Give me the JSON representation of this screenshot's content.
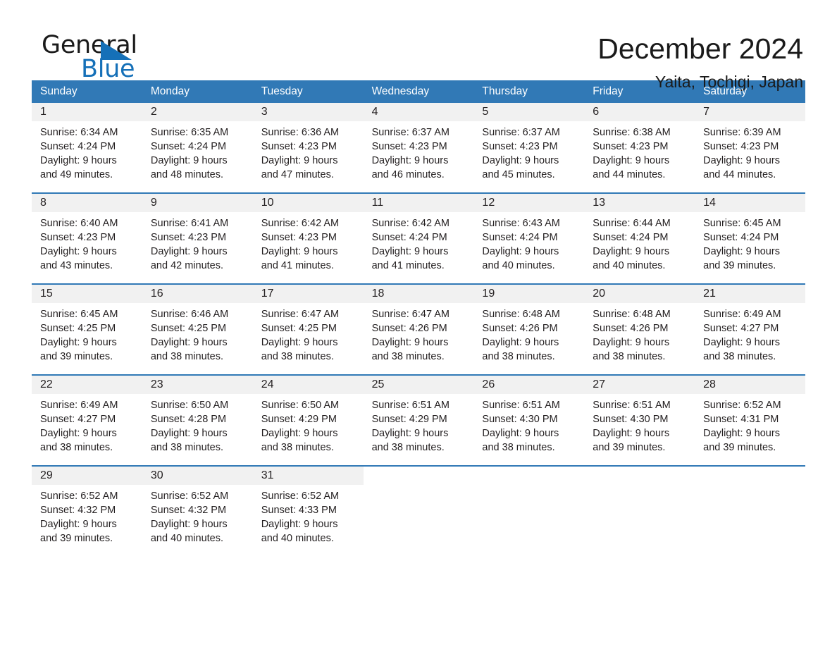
{
  "brand": {
    "name_part1": "General",
    "name_part2": "Blue",
    "accent_color": "#1570b8"
  },
  "header": {
    "title": "December 2024",
    "subtitle": "Yaita, Tochigi, Japan",
    "header_bg_color": "#3179b6",
    "row_divider_color": "#3179b6",
    "daynum_band_color": "#f1f1f1"
  },
  "weekdays": [
    "Sunday",
    "Monday",
    "Tuesday",
    "Wednesday",
    "Thursday",
    "Friday",
    "Saturday"
  ],
  "weeks": [
    [
      {
        "day": "1",
        "sunrise": "Sunrise: 6:34 AM",
        "sunset": "Sunset: 4:24 PM",
        "daylight1": "Daylight: 9 hours",
        "daylight2": "and 49 minutes."
      },
      {
        "day": "2",
        "sunrise": "Sunrise: 6:35 AM",
        "sunset": "Sunset: 4:24 PM",
        "daylight1": "Daylight: 9 hours",
        "daylight2": "and 48 minutes."
      },
      {
        "day": "3",
        "sunrise": "Sunrise: 6:36 AM",
        "sunset": "Sunset: 4:23 PM",
        "daylight1": "Daylight: 9 hours",
        "daylight2": "and 47 minutes."
      },
      {
        "day": "4",
        "sunrise": "Sunrise: 6:37 AM",
        "sunset": "Sunset: 4:23 PM",
        "daylight1": "Daylight: 9 hours",
        "daylight2": "and 46 minutes."
      },
      {
        "day": "5",
        "sunrise": "Sunrise: 6:37 AM",
        "sunset": "Sunset: 4:23 PM",
        "daylight1": "Daylight: 9 hours",
        "daylight2": "and 45 minutes."
      },
      {
        "day": "6",
        "sunrise": "Sunrise: 6:38 AM",
        "sunset": "Sunset: 4:23 PM",
        "daylight1": "Daylight: 9 hours",
        "daylight2": "and 44 minutes."
      },
      {
        "day": "7",
        "sunrise": "Sunrise: 6:39 AM",
        "sunset": "Sunset: 4:23 PM",
        "daylight1": "Daylight: 9 hours",
        "daylight2": "and 44 minutes."
      }
    ],
    [
      {
        "day": "8",
        "sunrise": "Sunrise: 6:40 AM",
        "sunset": "Sunset: 4:23 PM",
        "daylight1": "Daylight: 9 hours",
        "daylight2": "and 43 minutes."
      },
      {
        "day": "9",
        "sunrise": "Sunrise: 6:41 AM",
        "sunset": "Sunset: 4:23 PM",
        "daylight1": "Daylight: 9 hours",
        "daylight2": "and 42 minutes."
      },
      {
        "day": "10",
        "sunrise": "Sunrise: 6:42 AM",
        "sunset": "Sunset: 4:23 PM",
        "daylight1": "Daylight: 9 hours",
        "daylight2": "and 41 minutes."
      },
      {
        "day": "11",
        "sunrise": "Sunrise: 6:42 AM",
        "sunset": "Sunset: 4:24 PM",
        "daylight1": "Daylight: 9 hours",
        "daylight2": "and 41 minutes."
      },
      {
        "day": "12",
        "sunrise": "Sunrise: 6:43 AM",
        "sunset": "Sunset: 4:24 PM",
        "daylight1": "Daylight: 9 hours",
        "daylight2": "and 40 minutes."
      },
      {
        "day": "13",
        "sunrise": "Sunrise: 6:44 AM",
        "sunset": "Sunset: 4:24 PM",
        "daylight1": "Daylight: 9 hours",
        "daylight2": "and 40 minutes."
      },
      {
        "day": "14",
        "sunrise": "Sunrise: 6:45 AM",
        "sunset": "Sunset: 4:24 PM",
        "daylight1": "Daylight: 9 hours",
        "daylight2": "and 39 minutes."
      }
    ],
    [
      {
        "day": "15",
        "sunrise": "Sunrise: 6:45 AM",
        "sunset": "Sunset: 4:25 PM",
        "daylight1": "Daylight: 9 hours",
        "daylight2": "and 39 minutes."
      },
      {
        "day": "16",
        "sunrise": "Sunrise: 6:46 AM",
        "sunset": "Sunset: 4:25 PM",
        "daylight1": "Daylight: 9 hours",
        "daylight2": "and 38 minutes."
      },
      {
        "day": "17",
        "sunrise": "Sunrise: 6:47 AM",
        "sunset": "Sunset: 4:25 PM",
        "daylight1": "Daylight: 9 hours",
        "daylight2": "and 38 minutes."
      },
      {
        "day": "18",
        "sunrise": "Sunrise: 6:47 AM",
        "sunset": "Sunset: 4:26 PM",
        "daylight1": "Daylight: 9 hours",
        "daylight2": "and 38 minutes."
      },
      {
        "day": "19",
        "sunrise": "Sunrise: 6:48 AM",
        "sunset": "Sunset: 4:26 PM",
        "daylight1": "Daylight: 9 hours",
        "daylight2": "and 38 minutes."
      },
      {
        "day": "20",
        "sunrise": "Sunrise: 6:48 AM",
        "sunset": "Sunset: 4:26 PM",
        "daylight1": "Daylight: 9 hours",
        "daylight2": "and 38 minutes."
      },
      {
        "day": "21",
        "sunrise": "Sunrise: 6:49 AM",
        "sunset": "Sunset: 4:27 PM",
        "daylight1": "Daylight: 9 hours",
        "daylight2": "and 38 minutes."
      }
    ],
    [
      {
        "day": "22",
        "sunrise": "Sunrise: 6:49 AM",
        "sunset": "Sunset: 4:27 PM",
        "daylight1": "Daylight: 9 hours",
        "daylight2": "and 38 minutes."
      },
      {
        "day": "23",
        "sunrise": "Sunrise: 6:50 AM",
        "sunset": "Sunset: 4:28 PM",
        "daylight1": "Daylight: 9 hours",
        "daylight2": "and 38 minutes."
      },
      {
        "day": "24",
        "sunrise": "Sunrise: 6:50 AM",
        "sunset": "Sunset: 4:29 PM",
        "daylight1": "Daylight: 9 hours",
        "daylight2": "and 38 minutes."
      },
      {
        "day": "25",
        "sunrise": "Sunrise: 6:51 AM",
        "sunset": "Sunset: 4:29 PM",
        "daylight1": "Daylight: 9 hours",
        "daylight2": "and 38 minutes."
      },
      {
        "day": "26",
        "sunrise": "Sunrise: 6:51 AM",
        "sunset": "Sunset: 4:30 PM",
        "daylight1": "Daylight: 9 hours",
        "daylight2": "and 38 minutes."
      },
      {
        "day": "27",
        "sunrise": "Sunrise: 6:51 AM",
        "sunset": "Sunset: 4:30 PM",
        "daylight1": "Daylight: 9 hours",
        "daylight2": "and 39 minutes."
      },
      {
        "day": "28",
        "sunrise": "Sunrise: 6:52 AM",
        "sunset": "Sunset: 4:31 PM",
        "daylight1": "Daylight: 9 hours",
        "daylight2": "and 39 minutes."
      }
    ],
    [
      {
        "day": "29",
        "sunrise": "Sunrise: 6:52 AM",
        "sunset": "Sunset: 4:32 PM",
        "daylight1": "Daylight: 9 hours",
        "daylight2": "and 39 minutes."
      },
      {
        "day": "30",
        "sunrise": "Sunrise: 6:52 AM",
        "sunset": "Sunset: 4:32 PM",
        "daylight1": "Daylight: 9 hours",
        "daylight2": "and 40 minutes."
      },
      {
        "day": "31",
        "sunrise": "Sunrise: 6:52 AM",
        "sunset": "Sunset: 4:33 PM",
        "daylight1": "Daylight: 9 hours",
        "daylight2": "and 40 minutes."
      },
      {
        "day": "",
        "sunrise": "",
        "sunset": "",
        "daylight1": "",
        "daylight2": ""
      },
      {
        "day": "",
        "sunrise": "",
        "sunset": "",
        "daylight1": "",
        "daylight2": ""
      },
      {
        "day": "",
        "sunrise": "",
        "sunset": "",
        "daylight1": "",
        "daylight2": ""
      },
      {
        "day": "",
        "sunrise": "",
        "sunset": "",
        "daylight1": "",
        "daylight2": ""
      }
    ]
  ]
}
